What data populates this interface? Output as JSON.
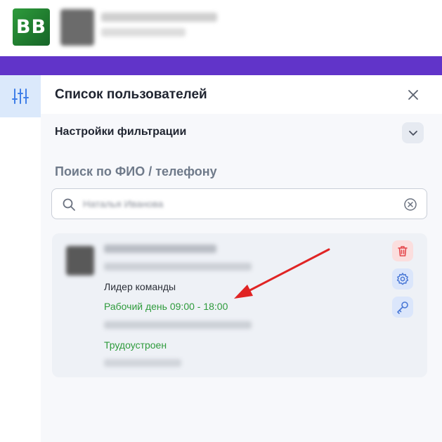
{
  "header": {
    "logo_text": "BB"
  },
  "panel": {
    "title": "Список пользователей",
    "filter_title": "Настройки фильтрации",
    "search_heading": "Поиск по ФИО / телефону",
    "search_value": "Наталья Иванова"
  },
  "user_card": {
    "role": "Лидер команды",
    "workday": "Рабочий день 09:00 - 18:00",
    "status": "Трудоустроен"
  },
  "icons": {
    "filter_toggle": "sliders-icon",
    "close": "close-icon",
    "chevron": "chevron-down-icon",
    "search": "search-icon",
    "clear": "clear-circle-icon",
    "delete": "trash-icon",
    "settings": "gear-icon",
    "key": "key-icon",
    "annotation": "red-arrow"
  },
  "colors": {
    "accent_purple": "#6134c9",
    "brand_green": "#2e9b3c",
    "delete_red": "#e5484d",
    "action_blue": "#4a78d6",
    "annotation_red": "#e02424"
  }
}
